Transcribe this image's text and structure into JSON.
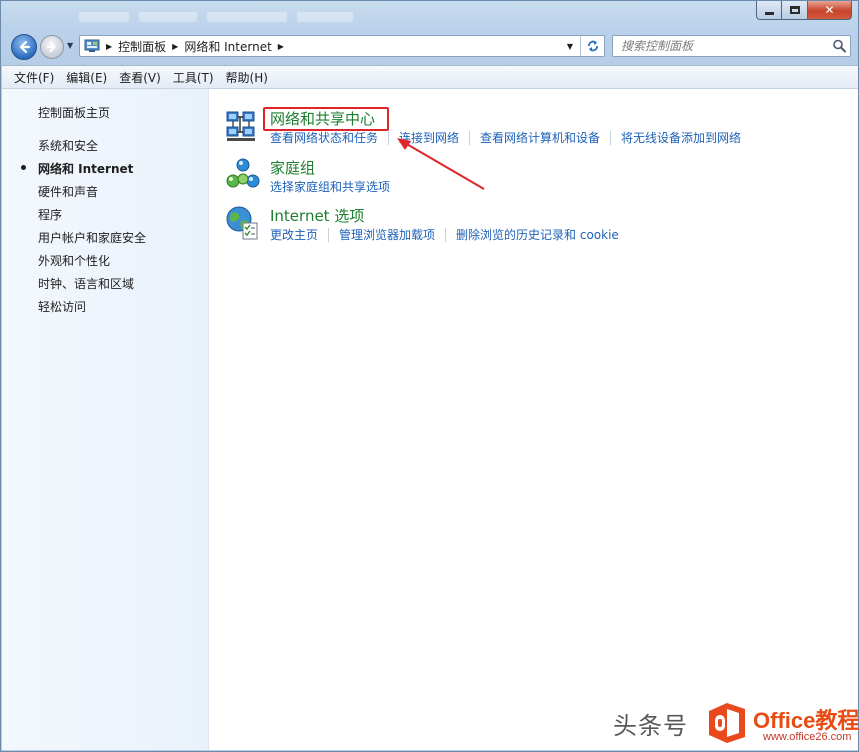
{
  "window": {
    "address": {
      "crumbs": [
        "控制面板",
        "网络和 Internet"
      ]
    },
    "search": {
      "placeholder": "搜索控制面板"
    }
  },
  "menubar": {
    "items": [
      "文件(F)",
      "编辑(E)",
      "查看(V)",
      "工具(T)",
      "帮助(H)"
    ]
  },
  "sidebar": {
    "home": "控制面板主页",
    "items": [
      {
        "label": "系统和安全",
        "active": false
      },
      {
        "label": "网络和 Internet",
        "active": true
      },
      {
        "label": "硬件和声音",
        "active": false
      },
      {
        "label": "程序",
        "active": false
      },
      {
        "label": "用户帐户和家庭安全",
        "active": false
      },
      {
        "label": "外观和个性化",
        "active": false
      },
      {
        "label": "时钟、语言和区域",
        "active": false
      },
      {
        "label": "轻松访问",
        "active": false
      }
    ]
  },
  "categories": [
    {
      "title": "网络和共享中心",
      "icon": "network-sharing-center-icon",
      "tasks": [
        "查看网络状态和任务",
        "连接到网络",
        "查看网络计算机和设备",
        "将无线设备添加到网络"
      ]
    },
    {
      "title": "家庭组",
      "icon": "homegroup-icon",
      "tasks": [
        "选择家庭组和共享选项"
      ]
    },
    {
      "title": "Internet 选项",
      "icon": "internet-options-icon",
      "tasks": [
        "更改主页",
        "管理浏览器加载项",
        "删除浏览的历史记录和 cookie"
      ]
    }
  ],
  "annotation": {
    "highlight_color": "#e0242a"
  },
  "watermark": {
    "text": "头条号",
    "brand": "Office教程网",
    "url": "www.office26.com"
  },
  "colors": {
    "link": "#1e61b8",
    "category_title": "#1c7e2e",
    "glass": "#b9d1ea"
  }
}
